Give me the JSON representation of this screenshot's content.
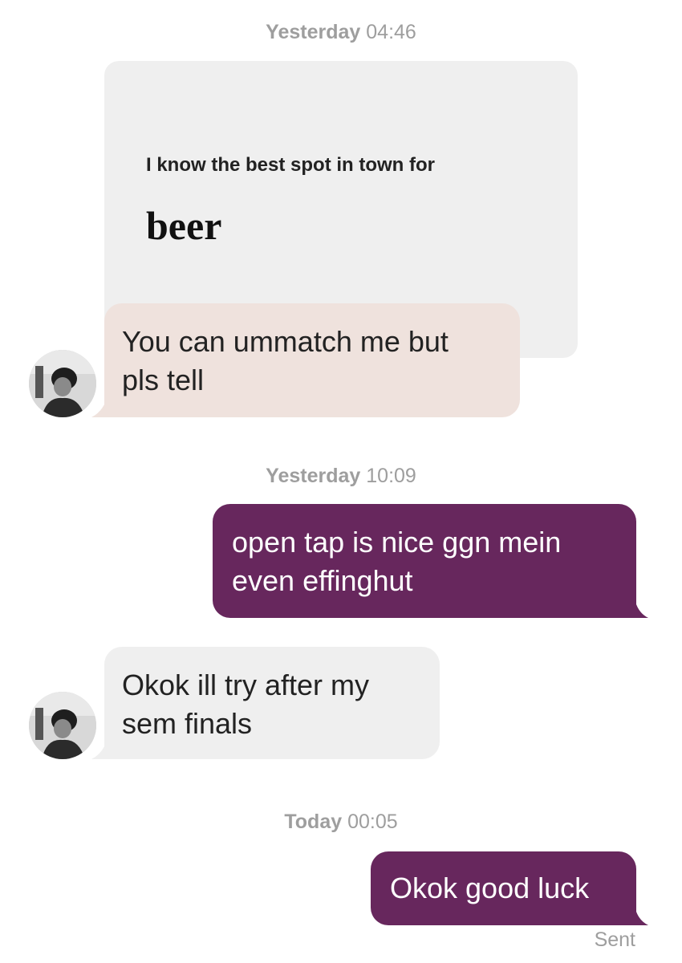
{
  "conversation": {
    "group1": {
      "day": "Yesterday",
      "time": "04:46"
    },
    "prompt": {
      "question": "I know the best spot in town for",
      "answer": "beer"
    },
    "reply_to_prompt": [
      "You can ummatch me but",
      "pls tell"
    ],
    "group2": {
      "day": "Yesterday",
      "time": "10:09"
    },
    "outgoing1": [
      "open tap is nice ggn mein",
      "even effinghut"
    ],
    "incoming2": [
      "Okok ill try after my",
      "sem finals"
    ],
    "group3": {
      "day": "Today",
      "time": "00:05"
    },
    "outgoing2": "Okok good luck",
    "status": "Sent"
  },
  "colors": {
    "outgoing_bubble": "#67275d",
    "incoming_bubble": "#efefef",
    "reply_bubble": "#efe2dd",
    "timestamp_text": "#9e9e9e"
  },
  "icons": [
    "avatar-photo"
  ]
}
